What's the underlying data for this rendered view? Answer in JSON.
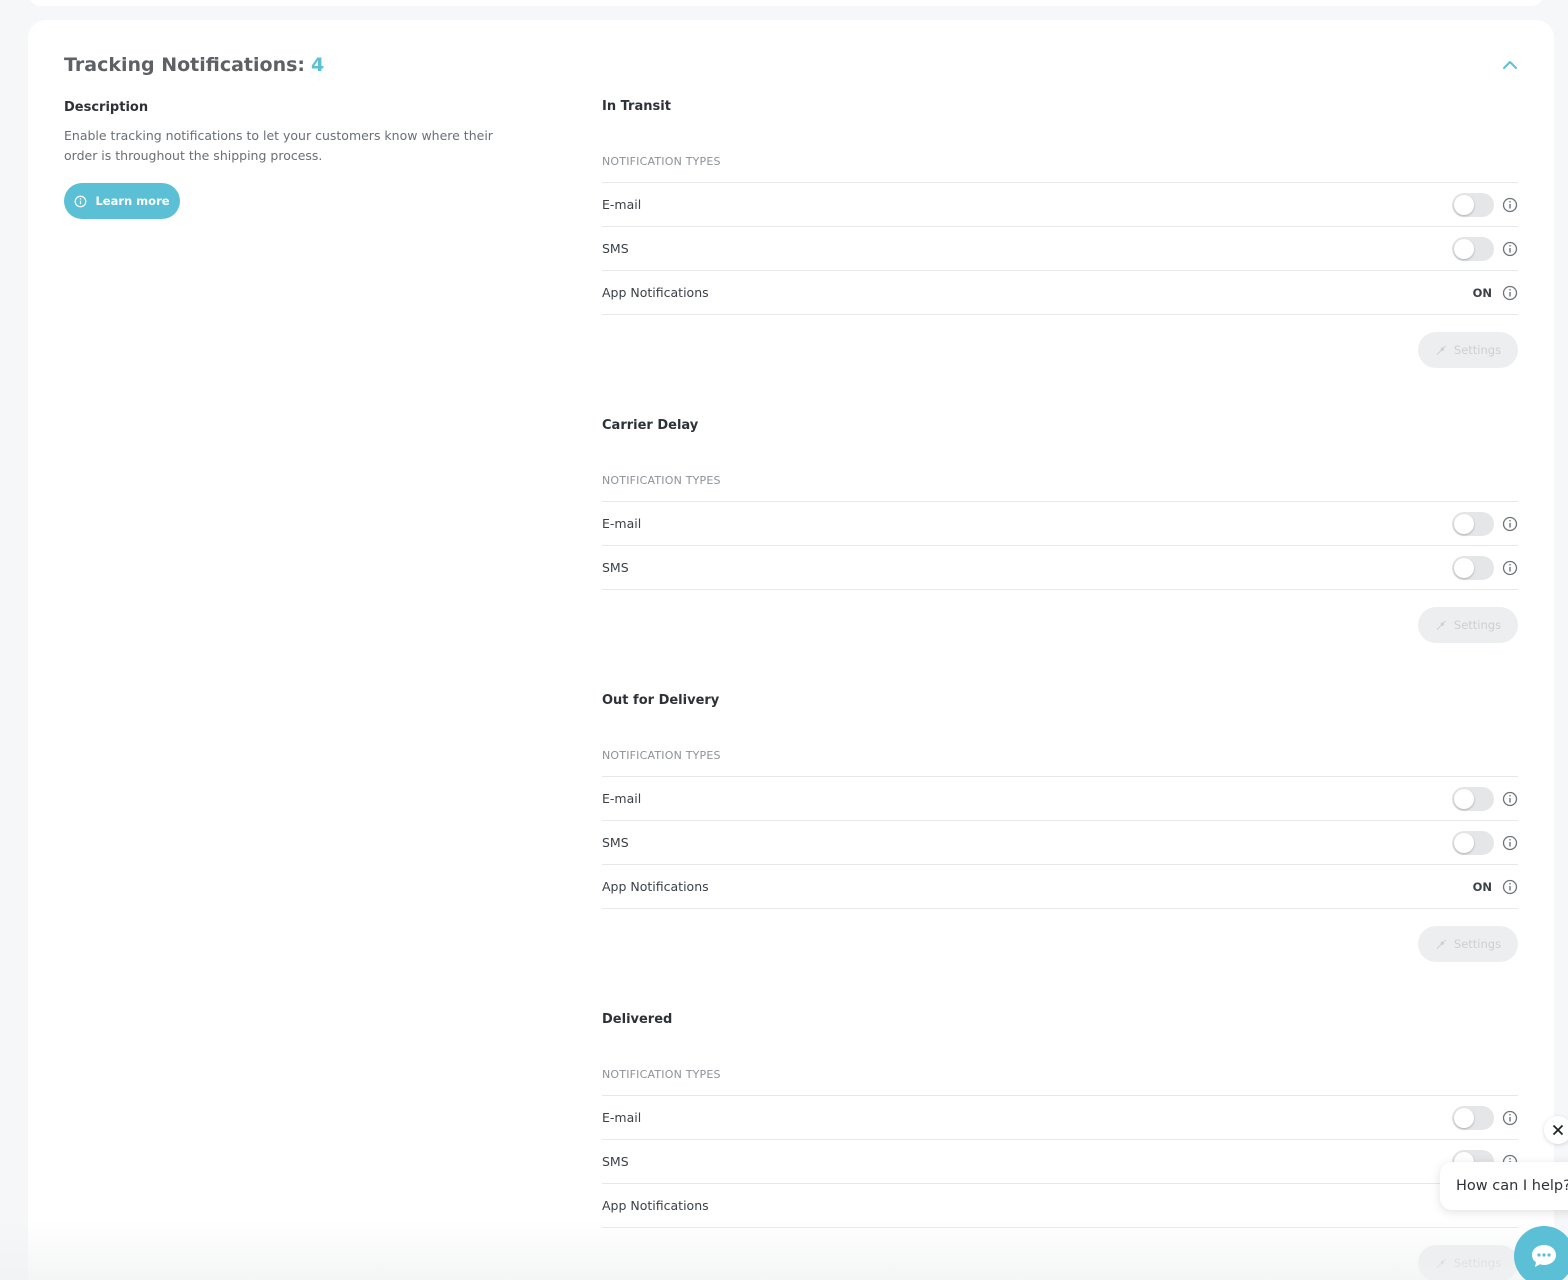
{
  "card": {
    "title": "Tracking Notifications:",
    "count": "4"
  },
  "description": {
    "heading": "Description",
    "text": "Enable tracking notifications to let your customers know where their order is throughout the shipping process.",
    "learn_more": "Learn more"
  },
  "sections": [
    {
      "title": "In Transit",
      "types_label": "NOTIFICATION TYPES",
      "rows": [
        {
          "label": "E-mail",
          "control": "toggle",
          "state": "off"
        },
        {
          "label": "SMS",
          "control": "toggle",
          "state": "off"
        },
        {
          "label": "App Notifications",
          "control": "text",
          "state_text": "ON"
        }
      ],
      "settings_label": "Settings"
    },
    {
      "title": "Carrier Delay",
      "types_label": "NOTIFICATION TYPES",
      "rows": [
        {
          "label": "E-mail",
          "control": "toggle",
          "state": "off"
        },
        {
          "label": "SMS",
          "control": "toggle",
          "state": "off"
        }
      ],
      "settings_label": "Settings"
    },
    {
      "title": "Out for Delivery",
      "types_label": "NOTIFICATION TYPES",
      "rows": [
        {
          "label": "E-mail",
          "control": "toggle",
          "state": "off"
        },
        {
          "label": "SMS",
          "control": "toggle",
          "state": "off"
        },
        {
          "label": "App Notifications",
          "control": "text",
          "state_text": "ON"
        }
      ],
      "settings_label": "Settings"
    },
    {
      "title": "Delivered",
      "types_label": "NOTIFICATION TYPES",
      "rows": [
        {
          "label": "E-mail",
          "control": "toggle",
          "state": "off"
        },
        {
          "label": "SMS",
          "control": "toggle",
          "state": "off"
        },
        {
          "label": "App Notifications",
          "control": "none"
        }
      ],
      "settings_label": "Settings"
    }
  ],
  "chat": {
    "prompt": "How can I help?"
  },
  "colors": {
    "accent": "#5bc0d6",
    "toggle_off": "#e4e6e8",
    "disabled_button": "#eceeef"
  },
  "icons": {
    "collapse": "chevron-up-icon",
    "info": "info-icon",
    "settings": "wrench-icon",
    "chat_close": "close-icon",
    "chat": "chat-bubble-icon"
  }
}
